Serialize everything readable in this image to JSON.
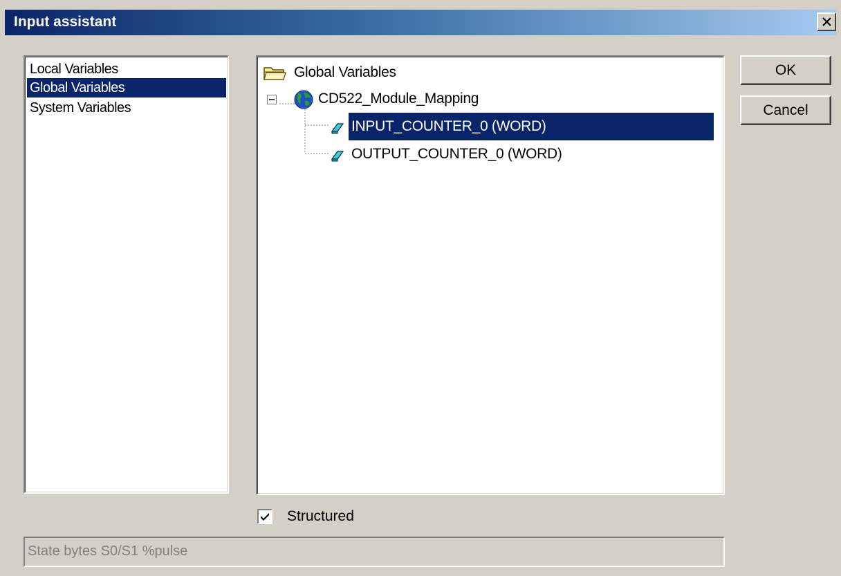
{
  "window": {
    "title": "Input assistant",
    "close_icon": "close-icon"
  },
  "categories": {
    "items": [
      {
        "label": "Local Variables",
        "selected": false
      },
      {
        "label": "Global Variables",
        "selected": true
      },
      {
        "label": "System Variables",
        "selected": false
      }
    ]
  },
  "tree": {
    "root": {
      "label": "Global Variables",
      "icon": "folder-icon"
    },
    "module": {
      "label": "CD522_Module_Mapping",
      "icon": "globe-icon",
      "expanded": true
    },
    "children": [
      {
        "label": "INPUT_COUNTER_0 (WORD)",
        "icon": "variable-icon",
        "selected": true
      },
      {
        "label": "OUTPUT_COUNTER_0 (WORD)",
        "icon": "variable-icon",
        "selected": false
      }
    ]
  },
  "buttons": {
    "ok_label": "OK",
    "cancel_label": "Cancel"
  },
  "options": {
    "structured_label": "Structured",
    "structured_checked": true
  },
  "status": {
    "text": "State bytes S0/S1 %pulse"
  },
  "colors": {
    "selection": "#0a246a",
    "face": "#d4d0c8",
    "title_start": "#0a246a",
    "title_end": "#a6caf0"
  }
}
